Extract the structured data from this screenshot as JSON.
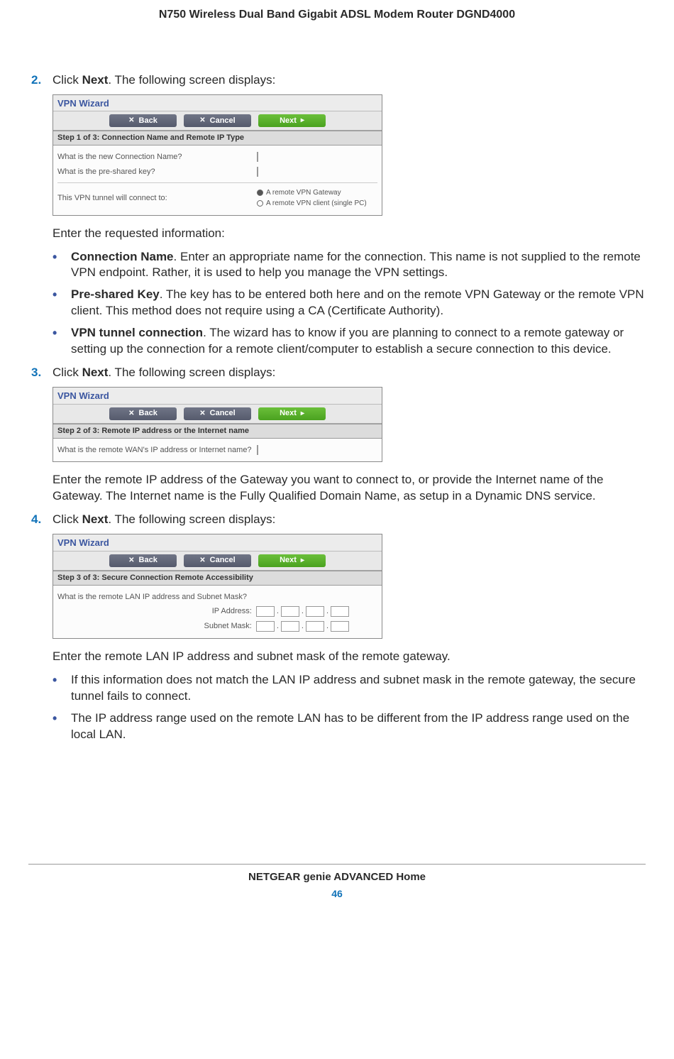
{
  "header": {
    "title": "N750 Wireless Dual Band Gigabit ADSL Modem Router DGND4000"
  },
  "step2": {
    "num": "2.",
    "intro_pre": "Click ",
    "intro_bold": "Next",
    "intro_post": ". The following screen displays:",
    "after_panel": "Enter the requested information:",
    "bullets": [
      {
        "bold": "Connection Name",
        "text": ". Enter an appropriate name for the connection. This name is not supplied to the remote VPN endpoint. Rather, it is used to help you manage the VPN settings."
      },
      {
        "bold": "Pre-shared Key",
        "text": ". The key has to be entered both here and on the remote VPN Gateway or the remote VPN client. This method does not require using a CA (Certificate Authority)."
      },
      {
        "bold": "VPN tunnel connection",
        "text": ". The wizard has to know if you are planning to connect to a remote gateway or setting up the connection for a remote client/computer to establish a secure connection to this device."
      }
    ]
  },
  "step3": {
    "num": "3.",
    "intro_pre": "Click ",
    "intro_bold": "Next",
    "intro_post": ". The following screen displays:",
    "after_panel": "Enter the remote IP address of the Gateway you want to connect to, or provide the Internet name of the Gateway. The Internet name is the Fully Qualified Domain Name, as setup in a Dynamic DNS service."
  },
  "step4": {
    "num": "4.",
    "intro_pre": "Click ",
    "intro_bold": "Next",
    "intro_post": ". The following screen displays:",
    "after_panel": "Enter the remote LAN IP address and subnet mask of the remote gateway.",
    "bullets": [
      {
        "text": "If this information does not match the LAN IP address and subnet mask in the remote gateway, the secure tunnel fails to connect."
      },
      {
        "text": "The IP address range used on the remote LAN has to be different from the IP address range used on the local LAN."
      }
    ]
  },
  "panels": {
    "wizard_title": "VPN Wizard",
    "buttons": {
      "back": "Back",
      "cancel": "Cancel",
      "next": "Next"
    },
    "p1": {
      "sub": "Step 1 of 3: Connection Name and Remote IP Type",
      "q1": "What is the new Connection Name?",
      "q2": "What is the pre-shared key?",
      "q3": "This VPN tunnel will connect to:",
      "opt1": "A remote VPN Gateway",
      "opt2": "A remote VPN client (single PC)"
    },
    "p2": {
      "sub": "Step 2 of 3: Remote IP address or the Internet name",
      "q1": "What is the remote WAN's IP address or Internet name?"
    },
    "p3": {
      "sub": "Step 3 of 3: Secure Connection Remote Accessibility",
      "q1": "What is the remote LAN IP address and Subnet Mask?",
      "ip_label": "IP Address:",
      "mask_label": "Subnet Mask:"
    }
  },
  "footer": {
    "title": "NETGEAR genie ADVANCED Home",
    "page": "46"
  }
}
